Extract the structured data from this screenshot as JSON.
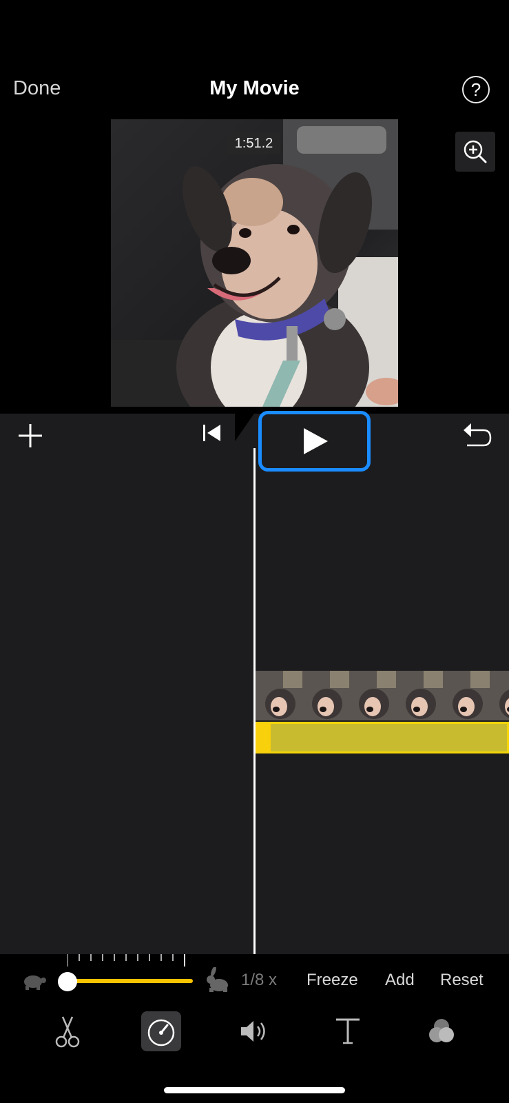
{
  "nav": {
    "done_label": "Done",
    "title": "My Movie",
    "help_label": "?"
  },
  "preview": {
    "timestamp": "1:51.2"
  },
  "speed": {
    "value_label": "1/8 x",
    "freeze_label": "Freeze",
    "add_label": "Add",
    "reset_label": "Reset",
    "level": 0.0
  },
  "toolbar": {
    "tools": [
      "scissors-icon",
      "speedometer-icon",
      "volume-icon",
      "text-icon",
      "filters-icon"
    ],
    "selected": "speedometer-icon"
  },
  "colors": {
    "accent_yellow": "#f8c300",
    "highlight_blue": "#1a8cff",
    "timeline_bg": "#1c1c1e"
  }
}
